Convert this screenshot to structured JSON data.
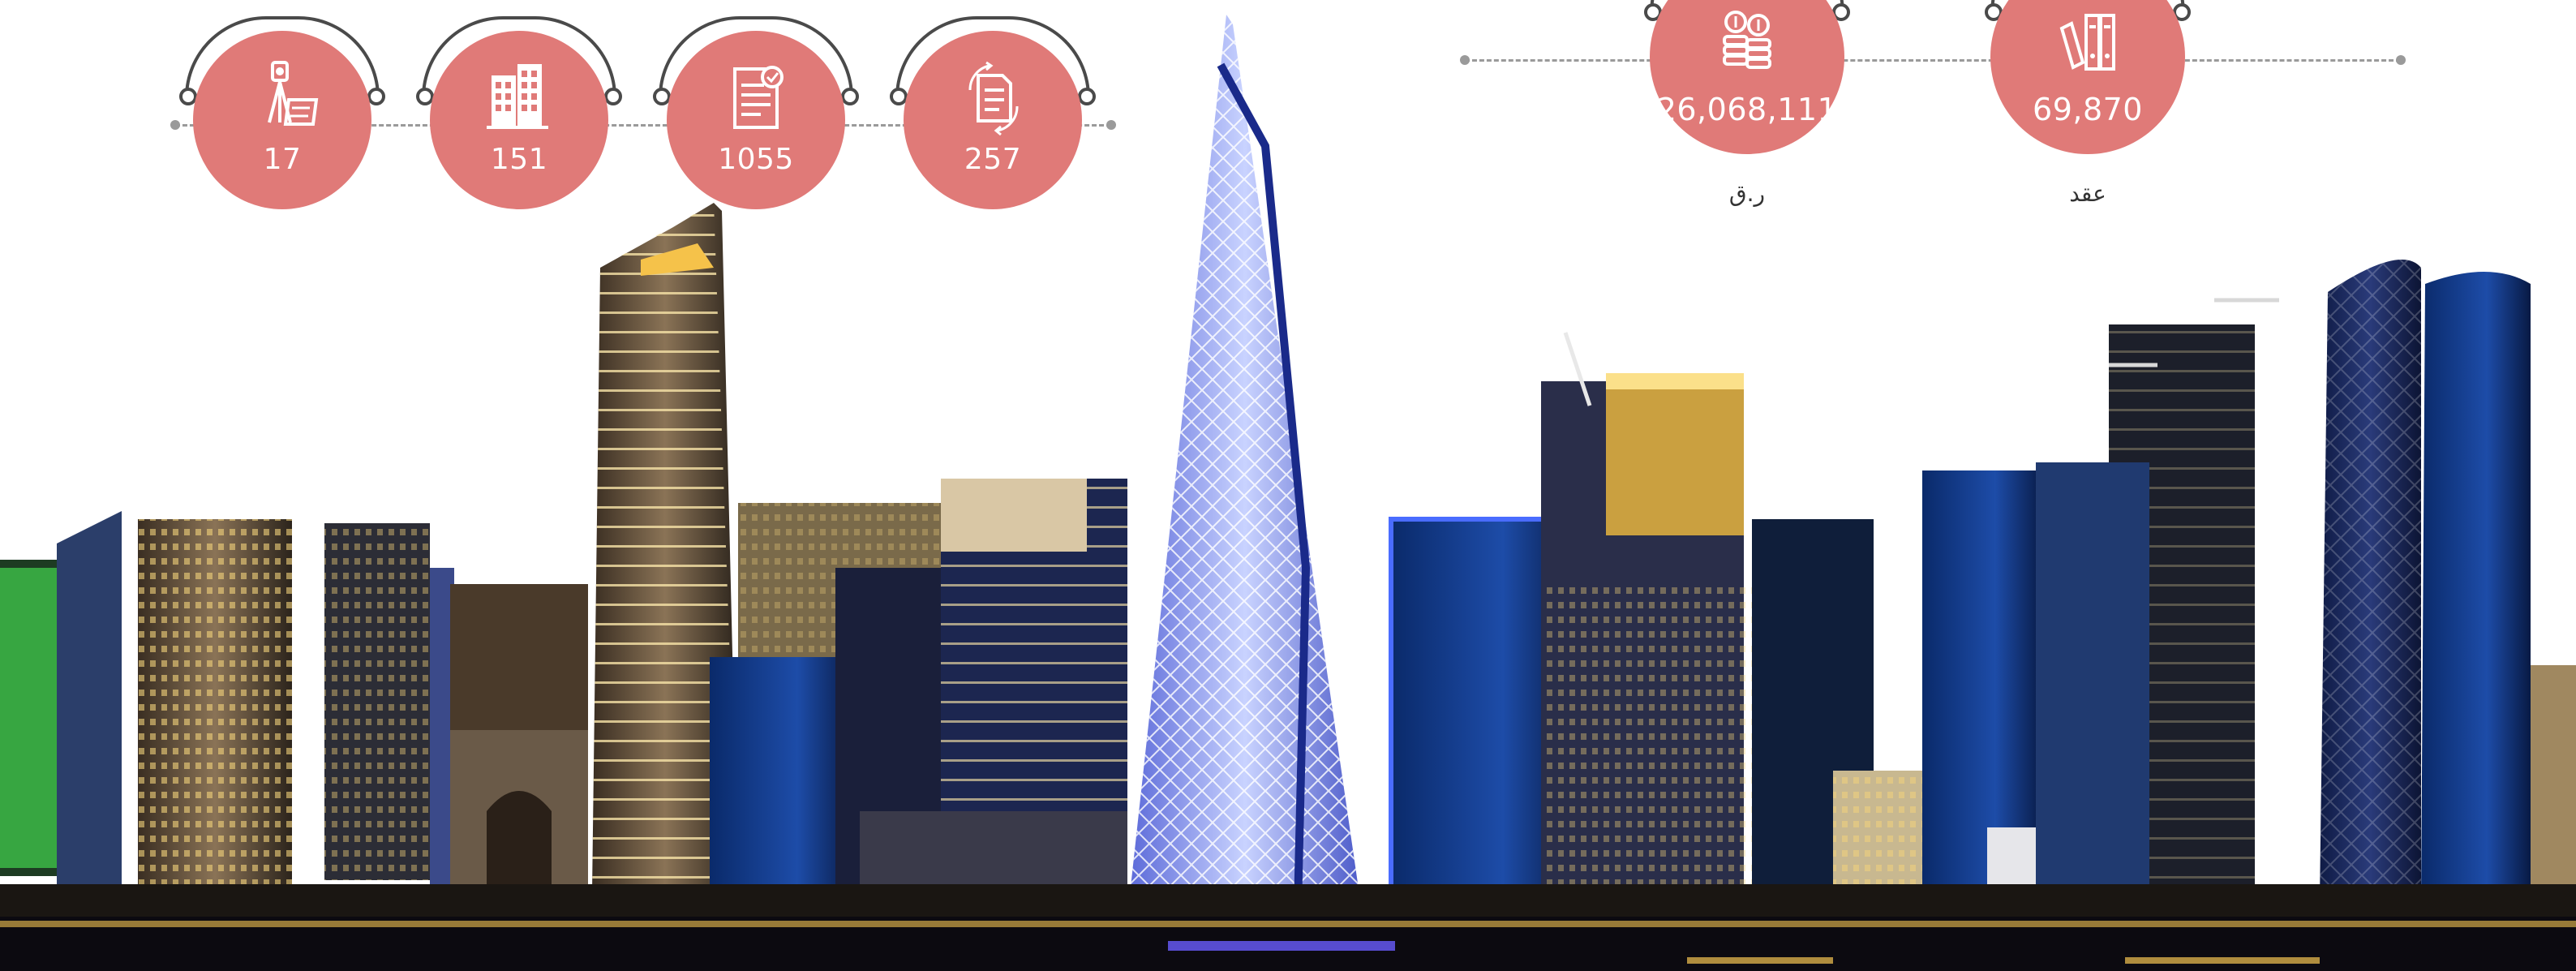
{
  "colors": {
    "badge": "#e07a78",
    "line": "#9a9a9a",
    "night_sky_building": "#1b2a5e",
    "glow": "#f6c453"
  },
  "left_stats": [
    {
      "icon": "surveyor-icon",
      "value": "17"
    },
    {
      "icon": "buildings-icon",
      "value": "151"
    },
    {
      "icon": "document-icon",
      "value": "1055"
    },
    {
      "icon": "document-cycle-icon",
      "value": "257"
    }
  ],
  "right_stats": [
    {
      "icon": "coins-icon",
      "value": "26,068,111",
      "unit": "ر.ق"
    },
    {
      "icon": "binders-icon",
      "value": "69,870",
      "unit": "عقد"
    }
  ]
}
